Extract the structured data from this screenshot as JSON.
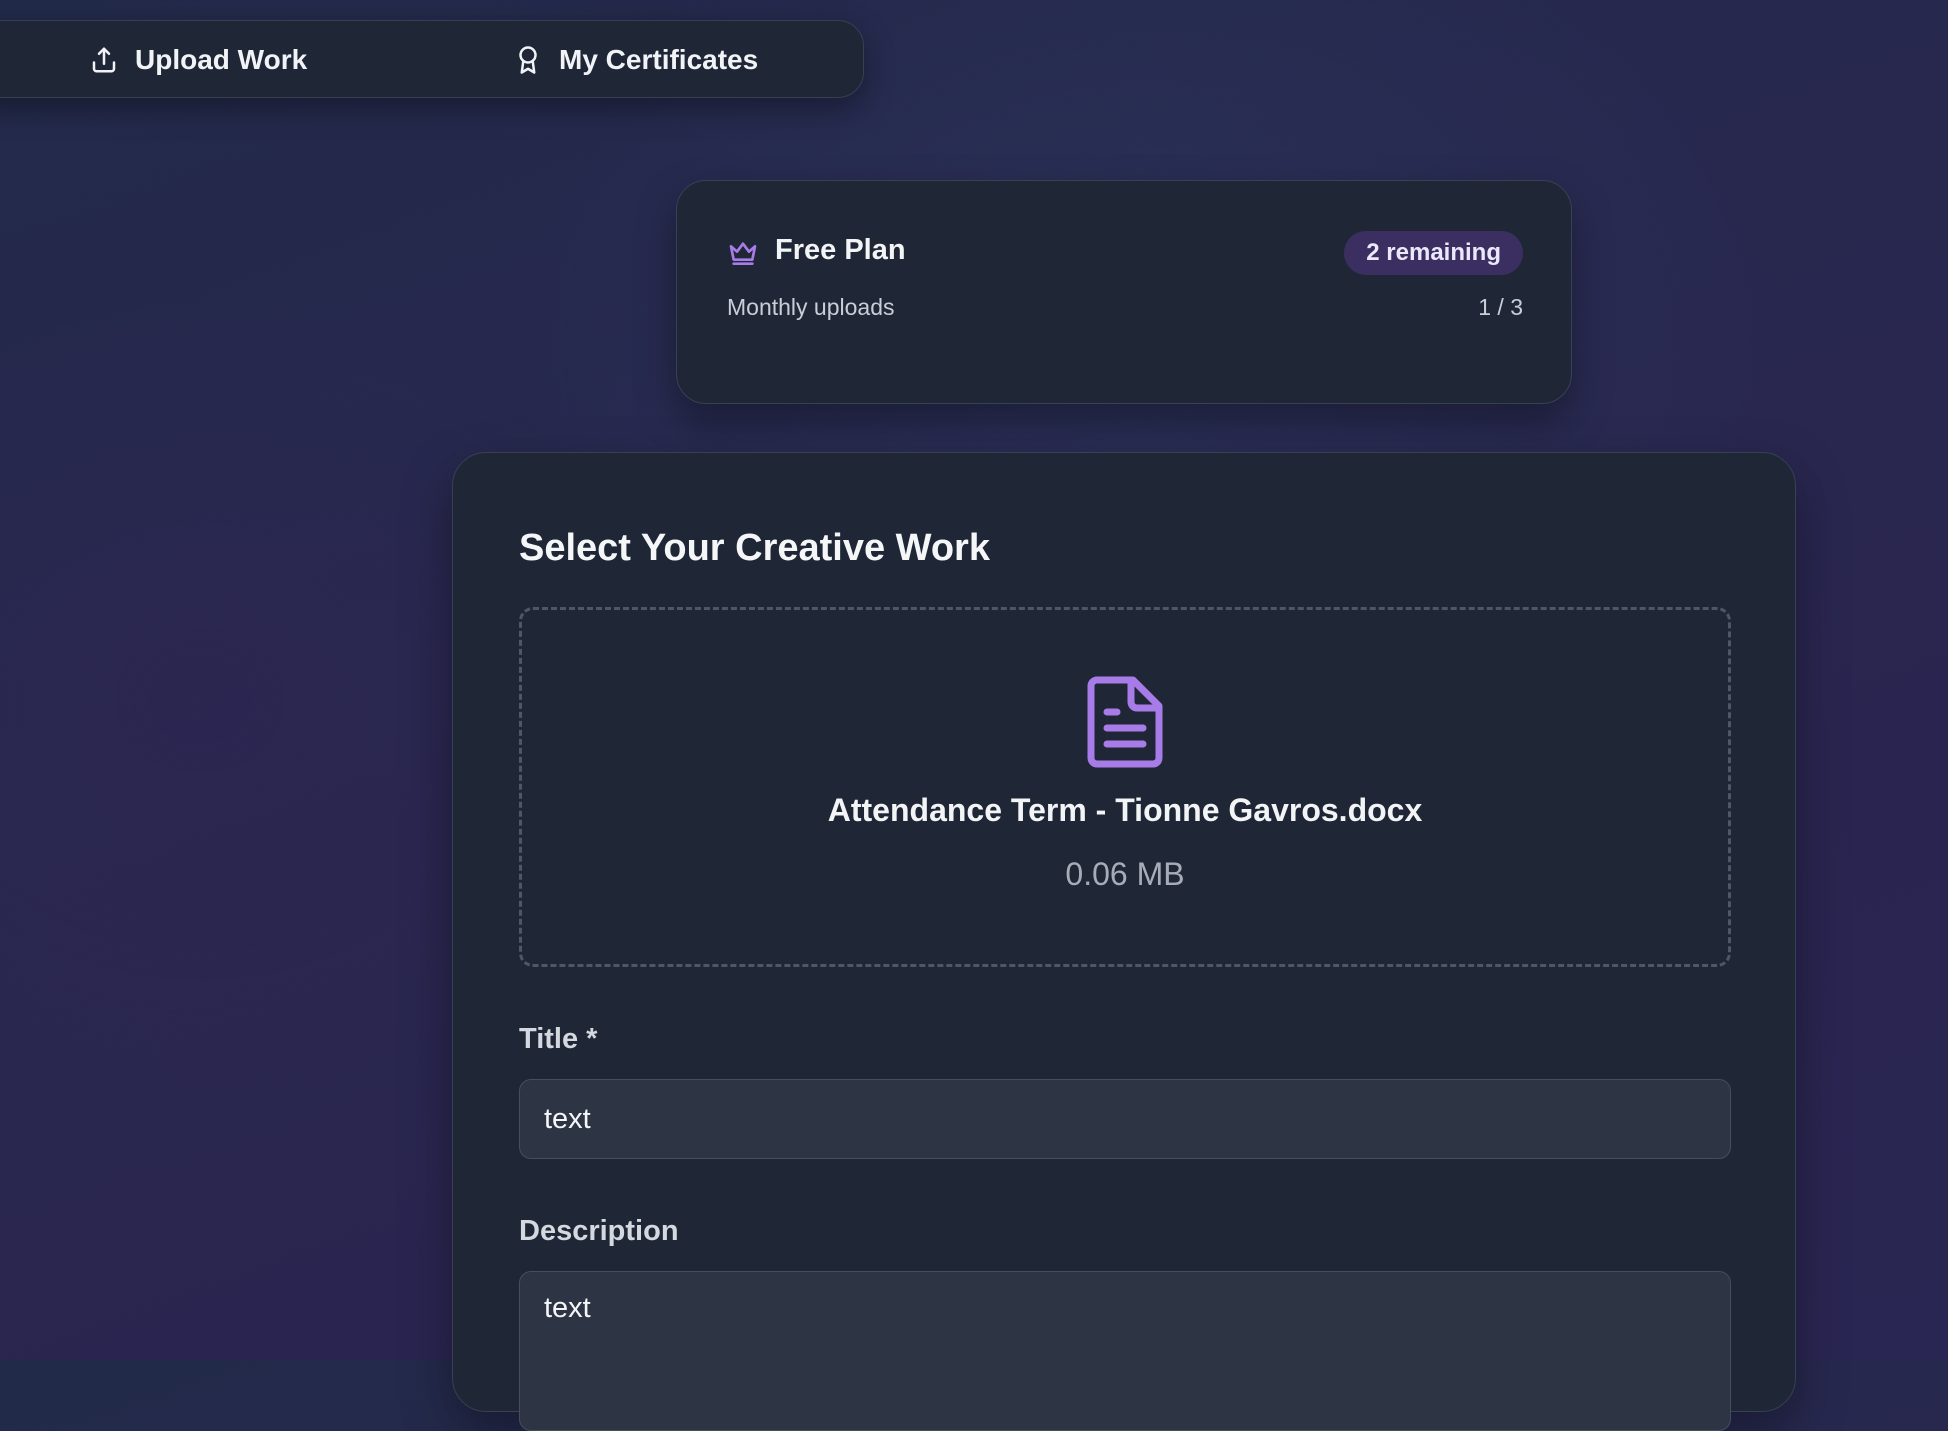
{
  "nav": {
    "items": [
      {
        "label": "Upload Work",
        "icon": "upload-icon"
      },
      {
        "label": "My Certificates",
        "icon": "award-icon"
      }
    ]
  },
  "plan": {
    "name": "Free Plan",
    "icon": "crown-icon",
    "badge": "2 remaining",
    "usage_label": "Monthly uploads",
    "usage_count": "1 / 3",
    "accent_color": "#a87ce8"
  },
  "form": {
    "title": "Select Your Creative Work",
    "file": {
      "icon": "document-icon",
      "name": "Attendance Term - Tionne Gavros.docx",
      "size": "0.06 MB"
    },
    "title_field": {
      "label": "Title *",
      "value": "text"
    },
    "description_field": {
      "label": "Description",
      "value": "text"
    }
  }
}
